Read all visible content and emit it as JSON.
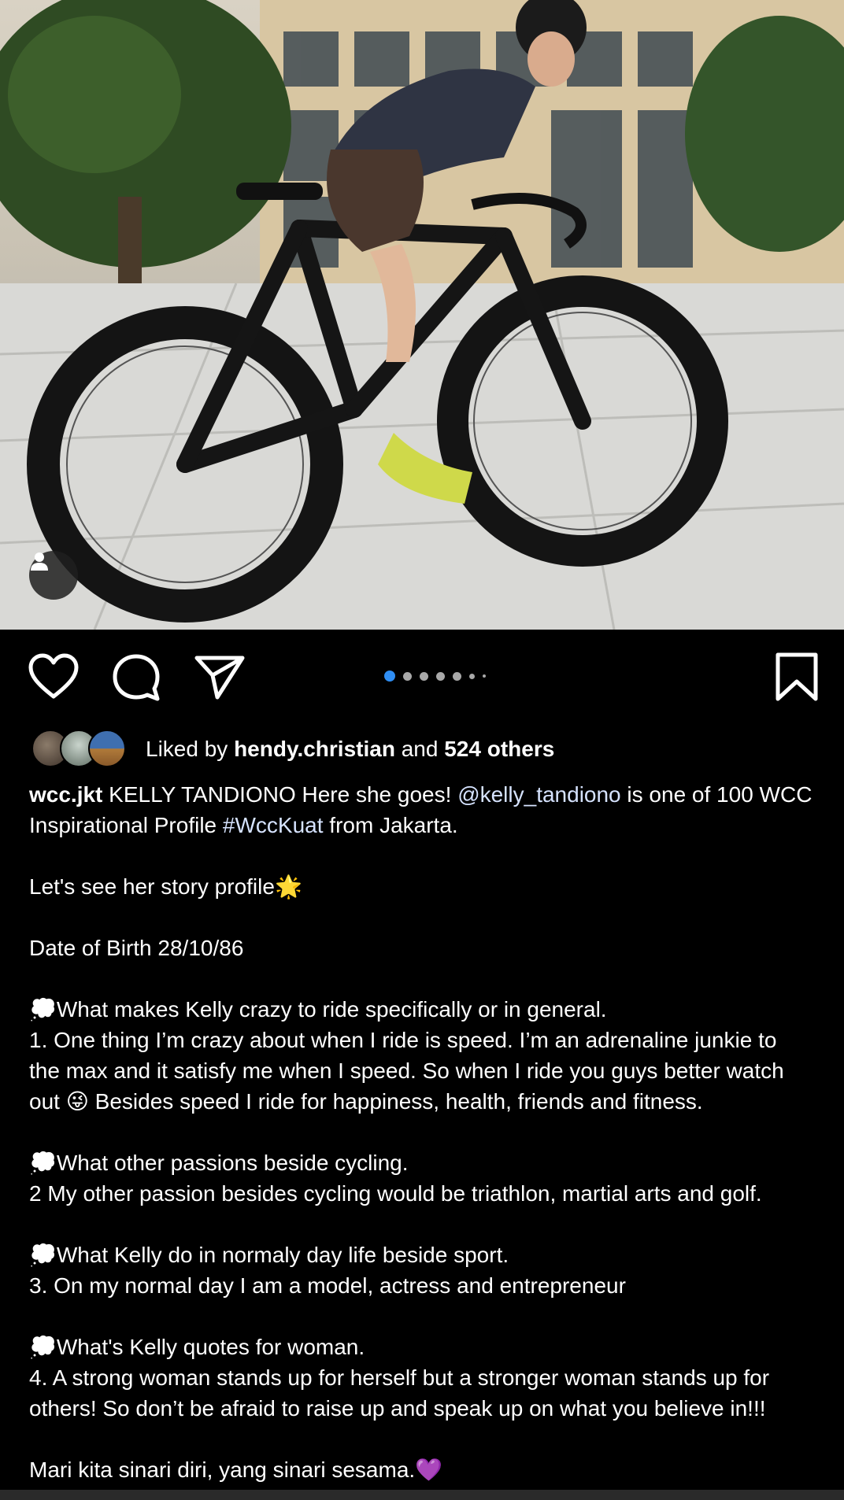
{
  "post": {
    "image_alt": "Cyclist on road bike",
    "carousel": {
      "count": 7,
      "active_index": 0
    }
  },
  "likes": {
    "prefix": "Liked by",
    "user": "hendy.christian",
    "conjunction": "and",
    "others": "524 others"
  },
  "caption": {
    "username": "wcc.jkt",
    "line1_text": " KELLY TANDIONO Here she goes! ",
    "mention": "@kelly_tandiono",
    "line1_rest": " is one of 100 WCC",
    "line2_pre": "Inspirational Profile ",
    "hashtag": "#WccKuat",
    "line2_post": " from Jakarta.",
    "story": "Let's see her story profile🌟",
    "dob": "Date of Birth 28/10/86",
    "q1": "💭What makes Kelly crazy to ride specifically or in general.",
    "a1_l1": "1. One thing I’m crazy about when I ride is speed. I’m an adrenaline junkie to",
    "a1_l2": "the max and it satisfy me when I speed. So when I ride you guys better watch",
    "a1_l3": "out 😜 Besides speed I ride for happiness, health, friends and fitness.",
    "q2": "💭What other passions beside cycling.",
    "a2": "2 My other passion besides cycling would be triathlon, martial arts and golf.",
    "q3": "💭What Kelly do in normaly day life beside sport.",
    "a3": "3. On my normal day I am a model, actress and entrepreneur",
    "q4": "💭What's Kelly quotes for woman.",
    "a4_l1": "4. A strong woman stands up for herself but a stronger woman stands up for",
    "a4_l2": "others! So don’t be afraid to raise up and speak up on what you believe in!!!",
    "closing": "Mari kita sinari diri, yang sinari sesama.💜"
  },
  "colors": {
    "background": "#000000",
    "accent_dot": "#2f8ef4",
    "link": "#d6e3ff"
  }
}
